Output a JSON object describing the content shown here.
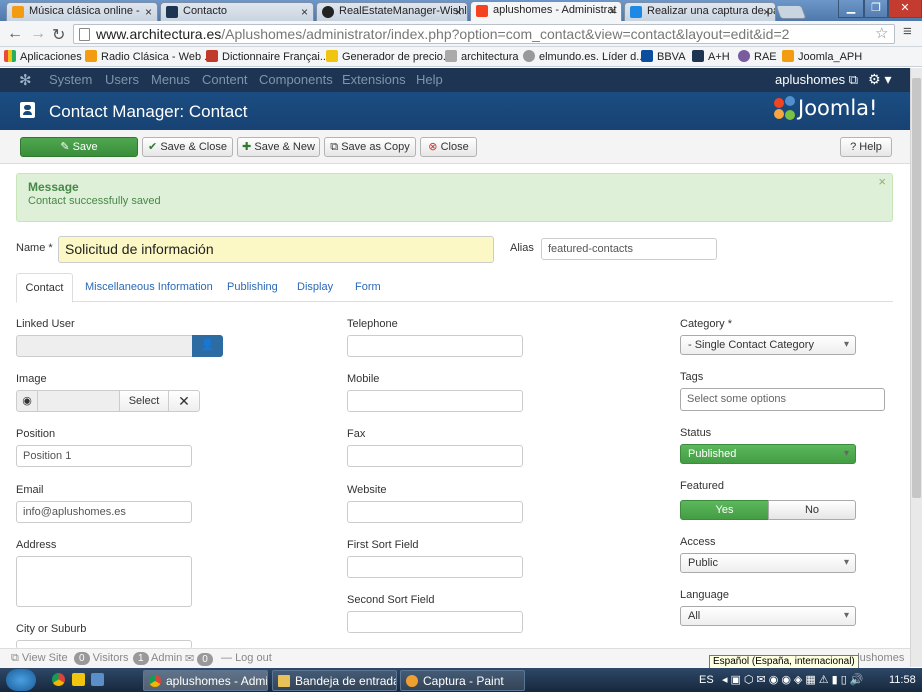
{
  "browser": {
    "tabs": [
      {
        "label": "Música clásica online -",
        "favcolor": "#f39c12",
        "favtext": "rtve"
      },
      {
        "label": "Contacto",
        "favcolor": "#1d3553"
      },
      {
        "label": "RealEstateManager-Wishli",
        "favcolor": "#222"
      },
      {
        "label": "aplushomes - Administrat",
        "favcolor": "#f44321"
      },
      {
        "label": "Realizar una captura de pa",
        "favcolor": "#1e88e5"
      }
    ],
    "url_host": "www.architectura.es",
    "url_path": "/Aplushomes/administrator/index.php?option=com_contact&view=contact&layout=edit&id=2",
    "bookmarks": [
      {
        "label": "Aplicaciones",
        "color": "#e74c3c"
      },
      {
        "label": "Radio Clásica - Web ...",
        "color": "#f39c12"
      },
      {
        "label": "Dictionnaire Françai...",
        "color": "#c0392b"
      },
      {
        "label": "Generador de precio...",
        "color": "#f1c40f"
      },
      {
        "label": "architectura",
        "color": "#888"
      },
      {
        "label": "elmundo.es. Líder d...",
        "color": "#888"
      },
      {
        "label": "BBVA",
        "color": "#0b4e9e"
      },
      {
        "label": "A+H",
        "color": "#1d3553"
      },
      {
        "label": "RAE",
        "color": "#7a5c9e"
      },
      {
        "label": "Joomla_APH",
        "color": "#f39c12"
      }
    ]
  },
  "joomla": {
    "menu": [
      "System",
      "Users",
      "Menus",
      "Content",
      "Components",
      "Extensions",
      "Help"
    ],
    "user": "aplushomes",
    "page_title": "Contact Manager: Contact",
    "logo": "Joomla!",
    "toolbar": {
      "save": "Save",
      "save_close": "Save & Close",
      "save_new": "Save & New",
      "save_copy": "Save as Copy",
      "close": "Close",
      "help": "Help"
    },
    "message": {
      "title": "Message",
      "text": "Contact successfully saved"
    },
    "form": {
      "name_label": "Name *",
      "name_value": "Solicitud de información",
      "alias_label": "Alias",
      "alias_value": "featured-contacts",
      "tabs": [
        "Contact",
        "Miscellaneous Information",
        "Publishing",
        "Display",
        "Form"
      ],
      "left": {
        "linked_user": "Linked User",
        "image": "Image",
        "image_select": "Select",
        "position": "Position",
        "position_value": "Position 1",
        "email": "Email",
        "email_value": "info@aplushomes.es",
        "address": "Address",
        "city": "City or Suburb"
      },
      "middle": {
        "telephone": "Telephone",
        "mobile": "Mobile",
        "fax": "Fax",
        "website": "Website",
        "first_sort": "First Sort Field",
        "second_sort": "Second Sort Field"
      },
      "right": {
        "category": "Category *",
        "category_value": "- Single Contact Category",
        "tags": "Tags",
        "tags_placeholder": "Select some options",
        "status": "Status",
        "status_value": "Published",
        "featured": "Featured",
        "yes": "Yes",
        "no": "No",
        "access": "Access",
        "access_value": "Public",
        "language": "Language",
        "language_value": "All"
      }
    },
    "statusbar": {
      "view_site": "View Site",
      "visitors_count": "0",
      "visitors": "Visitors",
      "admin_count": "1",
      "admin": "Admin",
      "msg_count": "0",
      "logout": "Log out",
      "right": "aplushomes"
    }
  },
  "taskbar": {
    "items": [
      "aplushomes - Admi...",
      "Bandeja de entrada ...",
      "Captura - Paint"
    ],
    "lang": "ES",
    "tooltip": "Español (España, internacional)",
    "time": "11:58"
  }
}
